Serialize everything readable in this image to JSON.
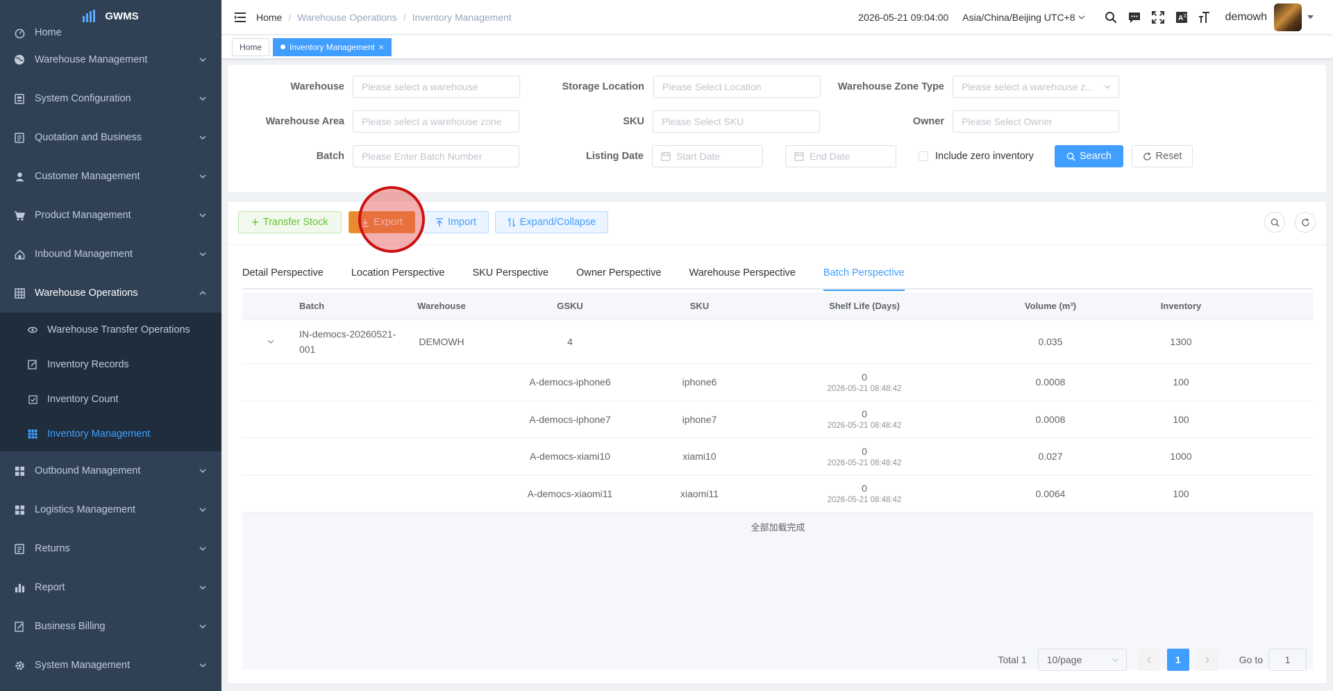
{
  "app": {
    "logo_text": "GWMS"
  },
  "sidebar": {
    "items": [
      {
        "label": "Home",
        "icon": "dashboard-icon"
      },
      {
        "label": "Warehouse Management",
        "icon": "globe-icon"
      },
      {
        "label": "System Configuration",
        "icon": "config-icon"
      },
      {
        "label": "Quotation and Business",
        "icon": "document-icon"
      },
      {
        "label": "Customer Management",
        "icon": "user-icon"
      },
      {
        "label": "Product Management",
        "icon": "cart-icon"
      },
      {
        "label": "Inbound Management",
        "icon": "home-icon"
      },
      {
        "label": "Warehouse Operations",
        "icon": "grid-icon"
      }
    ],
    "subitems": [
      {
        "label": "Warehouse Transfer Operations",
        "icon": "eye-icon"
      },
      {
        "label": "Inventory Records",
        "icon": "edit-icon"
      },
      {
        "label": "Inventory Count",
        "icon": "checkbox-icon"
      },
      {
        "label": "Inventory Management",
        "icon": "table-icon"
      }
    ],
    "items_after": [
      {
        "label": "Outbound Management",
        "icon": "apps-icon"
      },
      {
        "label": "Logistics Management",
        "icon": "apps-icon"
      },
      {
        "label": "Returns",
        "icon": "document-icon"
      },
      {
        "label": "Report",
        "icon": "chart-icon"
      },
      {
        "label": "Business Billing",
        "icon": "edit-icon"
      },
      {
        "label": "System Management",
        "icon": "gear-icon"
      }
    ]
  },
  "navbar": {
    "breadcrumb": [
      "Home",
      "Warehouse Operations",
      "Inventory Management"
    ],
    "datetime": "2026-05-21 09:04:00",
    "timezone": "Asia/China/Beijing UTC+8",
    "username": "demowh"
  },
  "tagsview": {
    "tags": [
      {
        "label": "Home",
        "active": false
      },
      {
        "label": "Inventory Management",
        "active": true,
        "close": "×"
      }
    ]
  },
  "filters": {
    "warehouse_label": "Warehouse",
    "warehouse_ph": "Please select a warehouse",
    "location_label": "Storage Location",
    "location_ph": "Please Select Location",
    "zone_type_label": "Warehouse Zone Type",
    "zone_type_ph": "Please select a warehouse z...",
    "area_label": "Warehouse Area",
    "area_ph": "Please select a warehouse zone",
    "sku_label": "SKU",
    "sku_ph": "Please Select SKU",
    "owner_label": "Owner",
    "owner_ph": "Please Select Owner",
    "batch_label": "Batch",
    "batch_ph": "Please Enter Batch Number",
    "listing_label": "Listing Date",
    "start_ph": "Start Date",
    "end_ph": "End Date",
    "zero_inv_label": "Include zero inventory",
    "search_label": "Search",
    "reset_label": "Reset"
  },
  "toolbar": {
    "transfer_label": "Transfer Stock",
    "export_label": "Export",
    "import_label": "Import",
    "expand_label": "Expand/Collapse"
  },
  "tabs": [
    {
      "label": "Detail Perspective",
      "active": false
    },
    {
      "label": "Location Perspective",
      "active": false
    },
    {
      "label": "SKU Perspective",
      "active": false
    },
    {
      "label": "Owner Perspective",
      "active": false
    },
    {
      "label": "Warehouse Perspective",
      "active": false
    },
    {
      "label": "Batch Perspective",
      "active": true
    }
  ],
  "table": {
    "headers": {
      "batch": "Batch",
      "warehouse": "Warehouse",
      "gsku": "GSKU",
      "sku": "SKU",
      "shelf": "Shelf Life (Days)",
      "volume": "Volume (m³)",
      "inventory": "Inventory"
    },
    "parent": {
      "batch": "IN-democs-20260521-001",
      "warehouse": "DEMOWH",
      "gsku": "4",
      "volume": "0.035",
      "inventory": "1300"
    },
    "children": [
      {
        "gsku": "A-democs-iphone6",
        "sku": "iphone6",
        "shelf": "0",
        "shelf_date": "2026-05-21 08:48:42",
        "volume": "0.0008",
        "inventory": "100"
      },
      {
        "gsku": "A-democs-iphone7",
        "sku": "iphone7",
        "shelf": "0",
        "shelf_date": "2026-05-21 08:48:42",
        "volume": "0.0008",
        "inventory": "100"
      },
      {
        "gsku": "A-democs-xiami10",
        "sku": "xiami10",
        "shelf": "0",
        "shelf_date": "2026-05-21 08:48:42",
        "volume": "0.027",
        "inventory": "1000"
      },
      {
        "gsku": "A-democs-xiaomi11",
        "sku": "xiaomi11",
        "shelf": "0",
        "shelf_date": "2026-05-21 08:48:42",
        "volume": "0.0064",
        "inventory": "100"
      }
    ],
    "footer": "全部加载完成"
  },
  "pagination": {
    "total": "Total 1",
    "page_size": "10/page",
    "current": "1",
    "goto_label": "Go to",
    "goto_value": "1"
  },
  "colors": {
    "sidebar_bg": "#304156",
    "primary": "#409eff",
    "export": "#e88a2d"
  }
}
